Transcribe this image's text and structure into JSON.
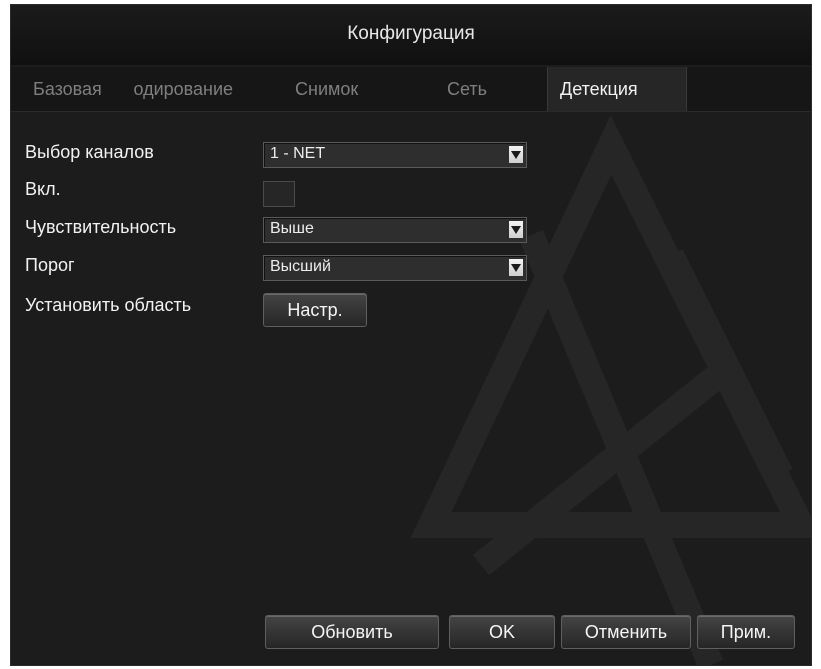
{
  "window": {
    "title": "Конфигурация"
  },
  "tabs": [
    {
      "label": "Базовая",
      "active": false
    },
    {
      "label": "Кодирование",
      "active": false
    },
    {
      "label": "Снимок",
      "active": false
    },
    {
      "label": "Сеть",
      "active": false
    },
    {
      "label": "Детекция",
      "active": true
    }
  ],
  "form": {
    "channel": {
      "label": "Выбор каналов",
      "value": "1 - NET"
    },
    "enable": {
      "label": "Вкл.",
      "checked": false
    },
    "sensitivity": {
      "label": "Чувствительность",
      "value": "Выше"
    },
    "threshold": {
      "label": "Порог",
      "value": "Высший"
    },
    "area": {
      "label": "Установить область",
      "button_label": "Настр."
    }
  },
  "footer": {
    "refresh_label": "Обновить",
    "ok_label": "OK",
    "cancel_label": "Отменить",
    "apply_label": "Прим."
  },
  "colors": {
    "background": "#1c1c1c",
    "text": "#f2f2f2",
    "inactive_tab_text": "#7f7f7f"
  },
  "icons": {
    "dropdown": "triangle-down-icon"
  }
}
